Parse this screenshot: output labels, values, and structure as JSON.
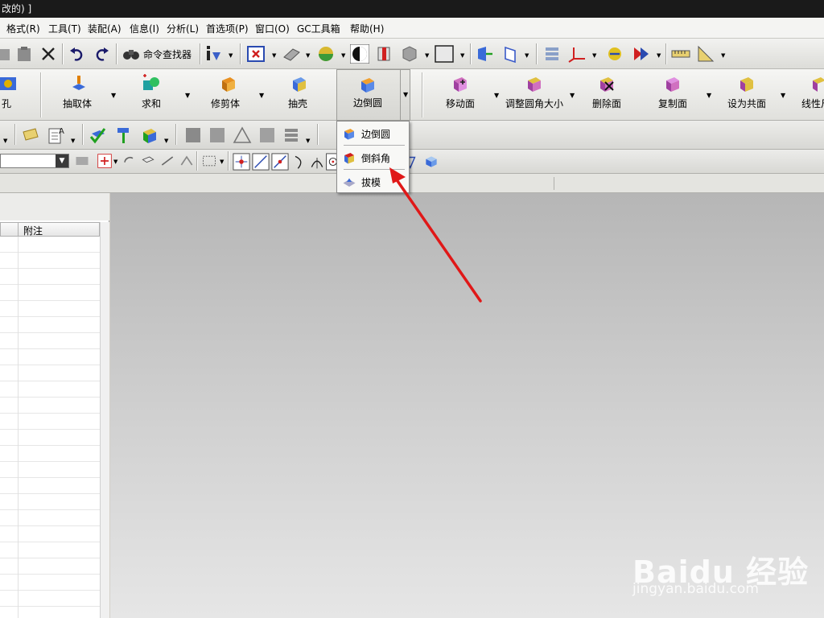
{
  "window": {
    "title": "改的) ]"
  },
  "menu": [
    {
      "label": "格式(R)"
    },
    {
      "label": "工具(T)"
    },
    {
      "label": "装配(A)"
    },
    {
      "label": "信息(I)"
    },
    {
      "label": "分析(L)"
    },
    {
      "label": "首选项(P)"
    },
    {
      "label": "窗口(O)"
    },
    {
      "label": "GC工具箱"
    },
    {
      "label": "帮助(H)"
    }
  ],
  "toolbar1": {
    "command_finder_label": "命令查找器"
  },
  "feature_toolbar": [
    {
      "label": "孔",
      "icon": "hole-icon"
    },
    {
      "label": "抽取体",
      "icon": "extract-body-icon"
    },
    {
      "label": "求和",
      "icon": "unite-icon"
    },
    {
      "label": "修剪体",
      "icon": "trim-body-icon"
    },
    {
      "label": "抽壳",
      "icon": "shell-icon"
    },
    {
      "label": "边倒圆",
      "icon": "edge-blend-icon"
    },
    {
      "label": "移动面",
      "icon": "move-face-icon"
    },
    {
      "label": "调整圆角大小",
      "icon": "resize-blend-icon"
    },
    {
      "label": "删除面",
      "icon": "delete-face-icon"
    },
    {
      "label": "复制面",
      "icon": "copy-face-icon"
    },
    {
      "label": "设为共面",
      "icon": "make-coplanar-icon"
    },
    {
      "label": "线性尺",
      "icon": "linear-dimension-icon"
    }
  ],
  "dropdown_menu": [
    {
      "label": "边倒圆",
      "icon": "edge-blend-icon"
    },
    {
      "label": "倒斜角",
      "icon": "chamfer-icon"
    },
    {
      "label": "拔模",
      "icon": "draft-icon"
    }
  ],
  "part_navigator": {
    "column_header": "附注"
  },
  "watermark": {
    "brand": "Baidu 经验",
    "url": "jingyan.baidu.com"
  },
  "colors": {
    "arrow": "#e01818",
    "titlebar": "#1a1a1a",
    "viewport_top": "#b6b6b6",
    "viewport_bottom": "#e6e6e6"
  }
}
